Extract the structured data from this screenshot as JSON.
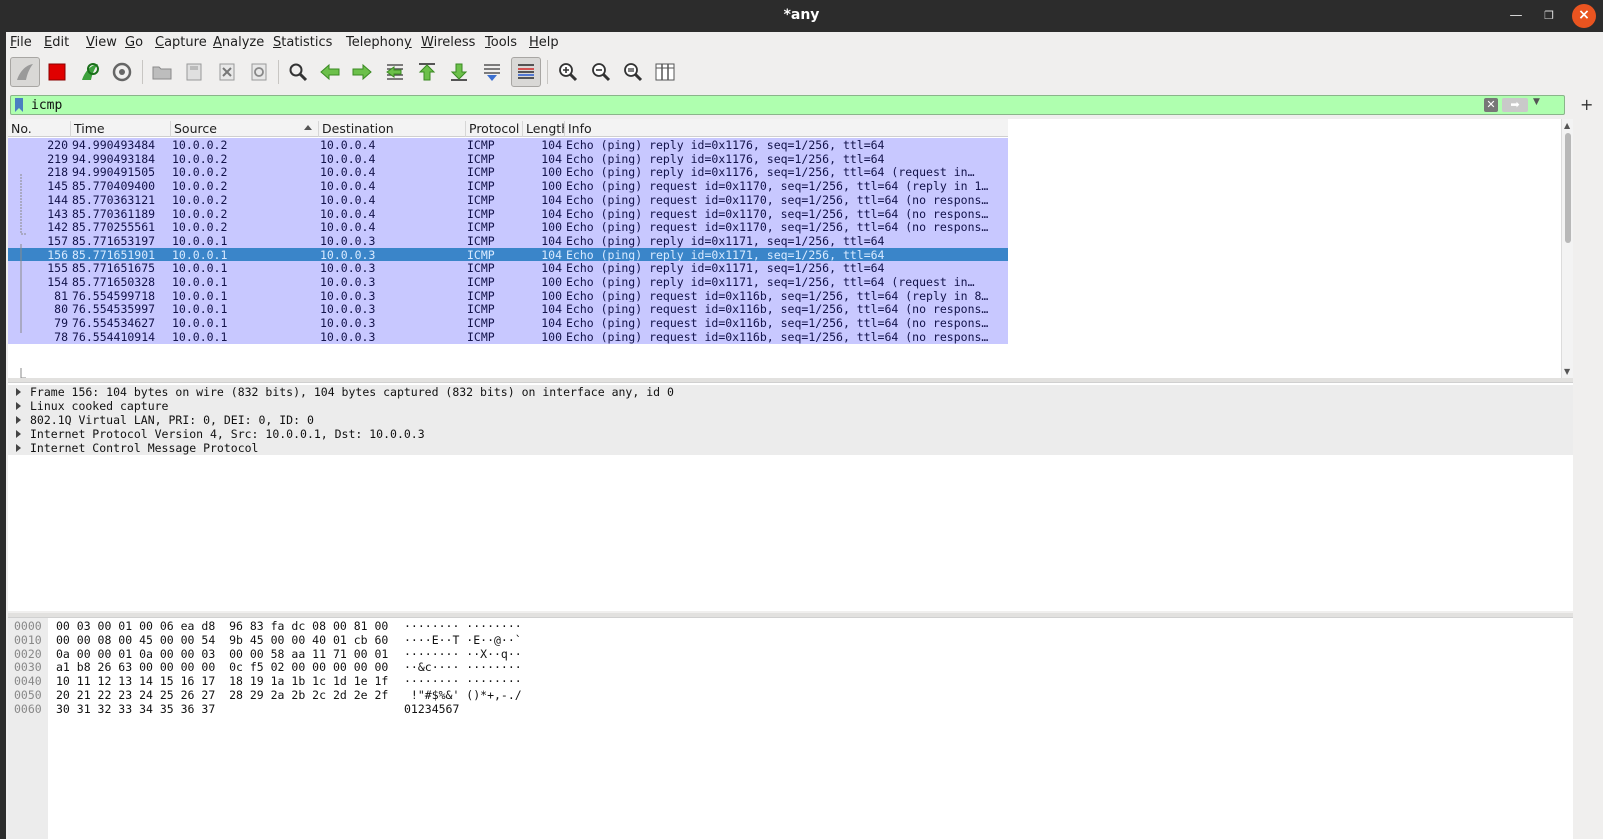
{
  "window": {
    "title": "*any"
  },
  "menu": [
    {
      "label": "File",
      "u": "F",
      "rest": "ile"
    },
    {
      "label": "Edit",
      "u": "E",
      "rest": "dit"
    },
    {
      "label": "View",
      "u": "V",
      "rest": "iew"
    },
    {
      "label": "Go",
      "u": "G",
      "rest": "o"
    },
    {
      "label": "Capture",
      "u": "C",
      "rest": "apture"
    },
    {
      "label": "Analyze",
      "u": "A",
      "rest": "nalyze"
    },
    {
      "label": "Statistics",
      "u": "S",
      "rest": "tatistics"
    },
    {
      "label": "Telephony",
      "u": "y",
      "rest": ""
    },
    {
      "label": "Wireless",
      "u": "W",
      "rest": "ireless"
    },
    {
      "label": "Tools",
      "u": "T",
      "rest": "ools"
    },
    {
      "label": "Help",
      "u": "H",
      "rest": "elp"
    }
  ],
  "filter": {
    "value": "icmp"
  },
  "columns": [
    "No.",
    "Time",
    "Source",
    "Destination",
    "Protocol",
    "Length",
    "Info"
  ],
  "packets": [
    {
      "no": "220",
      "time": "94.990493484",
      "src": "10.0.0.2",
      "dst": "10.0.0.4",
      "proto": "ICMP",
      "len": "104",
      "info": "Echo (ping) reply    id=0x1176, seq=1/256, ttl=64"
    },
    {
      "no": "219",
      "time": "94.990493184",
      "src": "10.0.0.2",
      "dst": "10.0.0.4",
      "proto": "ICMP",
      "len": "104",
      "info": "Echo (ping) reply    id=0x1176, seq=1/256, ttl=64"
    },
    {
      "no": "218",
      "time": "94.990491505",
      "src": "10.0.0.2",
      "dst": "10.0.0.4",
      "proto": "ICMP",
      "len": "100",
      "info": "Echo (ping) reply    id=0x1176, seq=1/256, ttl=64 (request in…"
    },
    {
      "no": "145",
      "time": "85.770409400",
      "src": "10.0.0.2",
      "dst": "10.0.0.4",
      "proto": "ICMP",
      "len": "100",
      "info": "Echo (ping) request  id=0x1170, seq=1/256, ttl=64 (reply in 1…"
    },
    {
      "no": "144",
      "time": "85.770363121",
      "src": "10.0.0.2",
      "dst": "10.0.0.4",
      "proto": "ICMP",
      "len": "104",
      "info": "Echo (ping) request  id=0x1170, seq=1/256, ttl=64 (no respons…"
    },
    {
      "no": "143",
      "time": "85.770361189",
      "src": "10.0.0.2",
      "dst": "10.0.0.4",
      "proto": "ICMP",
      "len": "104",
      "info": "Echo (ping) request  id=0x1170, seq=1/256, ttl=64 (no respons…"
    },
    {
      "no": "142",
      "time": "85.770255561",
      "src": "10.0.0.2",
      "dst": "10.0.0.4",
      "proto": "ICMP",
      "len": "100",
      "info": "Echo (ping) request  id=0x1170, seq=1/256, ttl=64 (no respons…"
    },
    {
      "no": "157",
      "time": "85.771653197",
      "src": "10.0.0.1",
      "dst": "10.0.0.3",
      "proto": "ICMP",
      "len": "104",
      "info": "Echo (ping) reply    id=0x1171, seq=1/256, ttl=64"
    },
    {
      "no": "156",
      "time": "85.771651901",
      "src": "10.0.0.1",
      "dst": "10.0.0.3",
      "proto": "ICMP",
      "len": "104",
      "info": "Echo (ping) reply    id=0x1171, seq=1/256, ttl=64",
      "selected": true
    },
    {
      "no": "155",
      "time": "85.771651675",
      "src": "10.0.0.1",
      "dst": "10.0.0.3",
      "proto": "ICMP",
      "len": "104",
      "info": "Echo (ping) reply    id=0x1171, seq=1/256, ttl=64"
    },
    {
      "no": "154",
      "time": "85.771650328",
      "src": "10.0.0.1",
      "dst": "10.0.0.3",
      "proto": "ICMP",
      "len": "100",
      "info": "Echo (ping) reply    id=0x1171, seq=1/256, ttl=64 (request in…"
    },
    {
      "no": "81",
      "time": "76.554599718",
      "src": "10.0.0.1",
      "dst": "10.0.0.3",
      "proto": "ICMP",
      "len": "100",
      "info": "Echo (ping) request  id=0x116b, seq=1/256, ttl=64 (reply in 8…"
    },
    {
      "no": "80",
      "time": "76.554535997",
      "src": "10.0.0.1",
      "dst": "10.0.0.3",
      "proto": "ICMP",
      "len": "104",
      "info": "Echo (ping) request  id=0x116b, seq=1/256, ttl=64 (no respons…"
    },
    {
      "no": "79",
      "time": "76.554534627",
      "src": "10.0.0.1",
      "dst": "10.0.0.3",
      "proto": "ICMP",
      "len": "104",
      "info": "Echo (ping) request  id=0x116b, seq=1/256, ttl=64 (no respons…"
    },
    {
      "no": "78",
      "time": "76.554410914",
      "src": "10.0.0.1",
      "dst": "10.0.0.3",
      "proto": "ICMP",
      "len": "100",
      "info": "Echo (ping) request  id=0x116b, seq=1/256, ttl=64 (no respons…"
    }
  ],
  "details": [
    "Frame 156: 104 bytes on wire (832 bits), 104 bytes captured (832 bits) on interface any, id 0",
    "Linux cooked capture",
    "802.1Q Virtual LAN, PRI: 0, DEI: 0, ID: 0",
    "Internet Protocol Version 4, Src: 10.0.0.1, Dst: 10.0.0.3",
    "Internet Control Message Protocol"
  ],
  "bytes": [
    {
      "off": "0000",
      "hex": "00 03 00 01 00 06 ea d8  96 83 fa dc 08 00 81 00",
      "ascii": "········ ········"
    },
    {
      "off": "0010",
      "hex": "00 00 08 00 45 00 00 54  9b 45 00 00 40 01 cb 60",
      "ascii": "····E··T ·E··@··`"
    },
    {
      "off": "0020",
      "hex": "0a 00 00 01 0a 00 00 03  00 00 58 aa 11 71 00 01",
      "ascii": "········ ··X··q··"
    },
    {
      "off": "0030",
      "hex": "a1 b8 26 63 00 00 00 00  0c f5 02 00 00 00 00 00",
      "ascii": "··&c···· ········"
    },
    {
      "off": "0040",
      "hex": "10 11 12 13 14 15 16 17  18 19 1a 1b 1c 1d 1e 1f",
      "ascii": "········ ········"
    },
    {
      "off": "0050",
      "hex": "20 21 22 23 24 25 26 27  28 29 2a 2b 2c 2d 2e 2f",
      "ascii": " !\"#$%&' ()*+,-./"
    },
    {
      "off": "0060",
      "hex": "30 31 32 33 34 35 36 37",
      "ascii": "01234567"
    }
  ],
  "colors": {
    "row_bg": "#c8c8ff",
    "row_selected": "#3a85c9",
    "filter_ok": "#afffaf",
    "close_button": "#e95420"
  },
  "toolbar_icons": [
    "start-capture-icon",
    "stop-capture-icon",
    "restart-capture-icon",
    "capture-options-icon",
    "open-file-icon",
    "save-file-icon",
    "close-file-icon",
    "reload-file-icon",
    "find-packet-icon",
    "go-back-icon",
    "go-forward-icon",
    "go-to-packet-icon",
    "go-first-icon",
    "go-last-icon",
    "autoscroll-icon",
    "colorize-icon",
    "zoom-in-icon",
    "zoom-out-icon",
    "zoom-normal-icon",
    "resize-columns-icon"
  ]
}
